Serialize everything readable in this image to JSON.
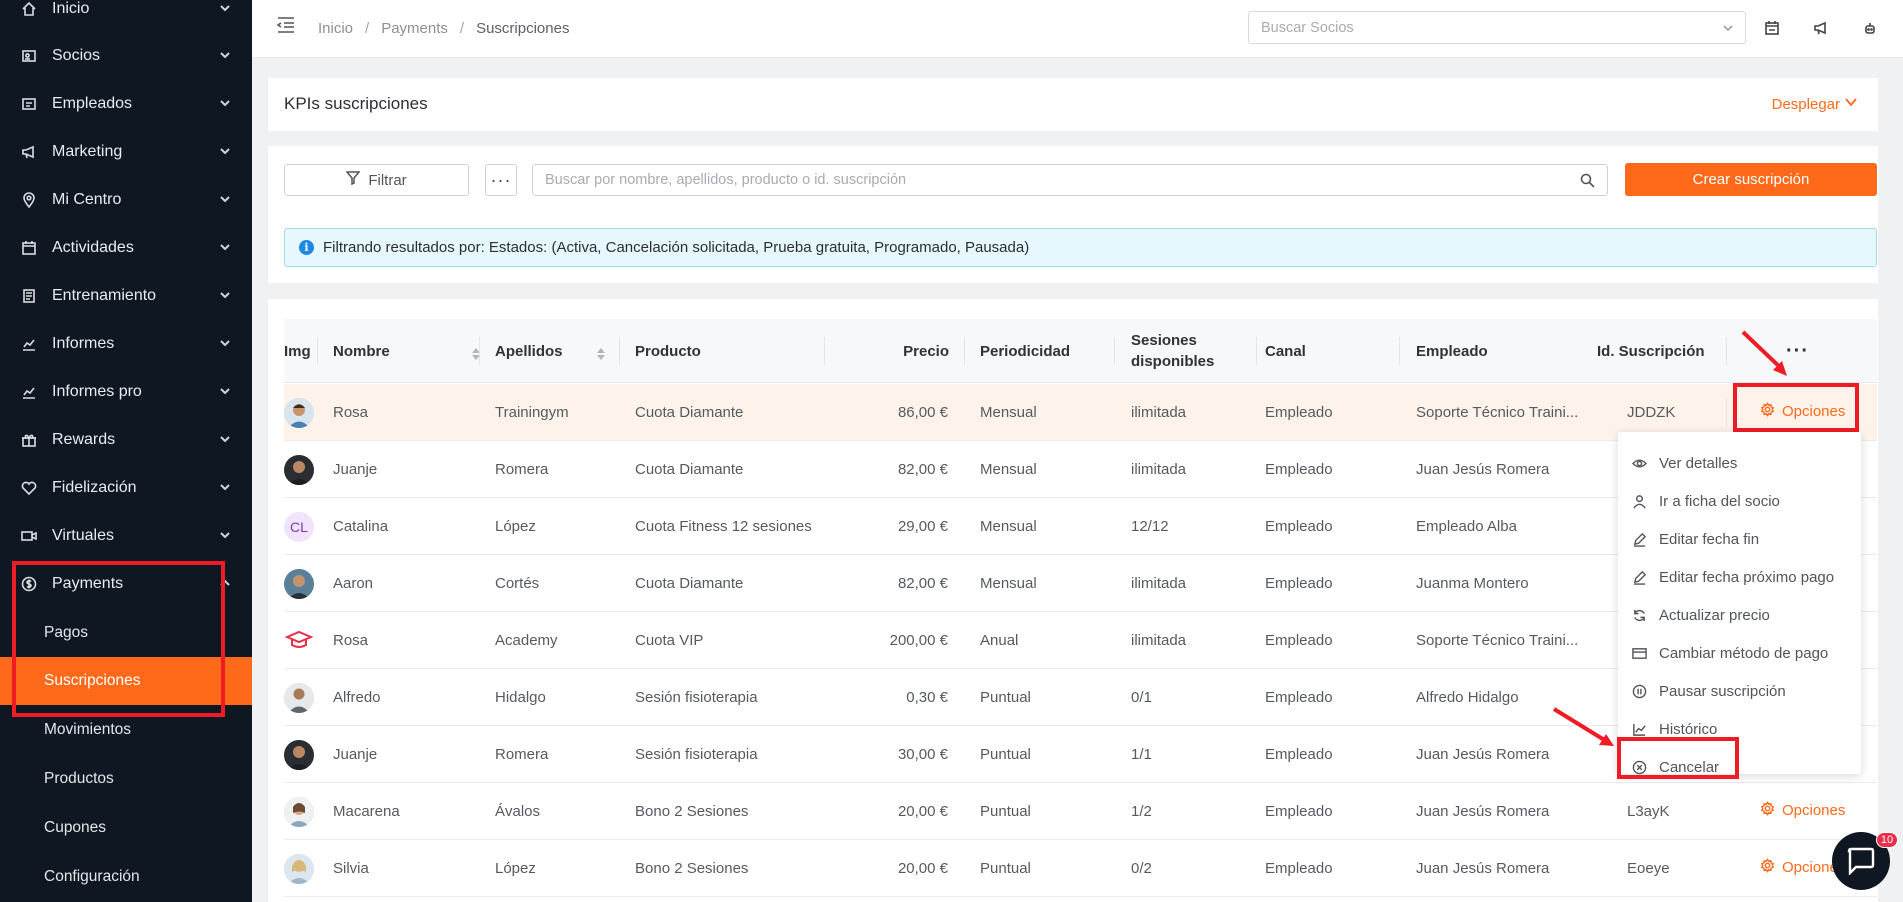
{
  "sidebar": {
    "items": [
      {
        "label": "Inicio",
        "icon": "home-icon"
      },
      {
        "label": "Socios",
        "icon": "id-card-icon"
      },
      {
        "label": "Empleados",
        "icon": "badge-icon"
      },
      {
        "label": "Marketing",
        "icon": "megaphone-icon"
      },
      {
        "label": "Mi Centro",
        "icon": "location-icon"
      },
      {
        "label": "Actividades",
        "icon": "calendar-icon"
      },
      {
        "label": "Entrenamiento",
        "icon": "clipboard-icon"
      },
      {
        "label": "Informes",
        "icon": "chart-line-icon"
      },
      {
        "label": "Informes pro",
        "icon": "chart-line-icon"
      },
      {
        "label": "Rewards",
        "icon": "gift-icon"
      },
      {
        "label": "Fidelización",
        "icon": "heart-icon"
      },
      {
        "label": "Virtuales",
        "icon": "video-icon"
      },
      {
        "label": "Payments",
        "icon": "coin-icon"
      }
    ],
    "payments_subitems": [
      "Pagos",
      "Suscripciones",
      "Movimientos",
      "Productos",
      "Cupones",
      "Configuración"
    ],
    "active_subitem": "Suscripciones"
  },
  "topbar": {
    "breadcrumb": [
      "Inicio",
      "Payments",
      "Suscripciones"
    ],
    "search_placeholder": "Buscar Socios"
  },
  "kpi": {
    "title": "KPIs suscripciones",
    "toggle_label": "Desplegar"
  },
  "filters": {
    "filter_label": "Filtrar",
    "more_label": "···",
    "search_placeholder": "Buscar por nombre, apellidos, producto o id. suscripción",
    "create_label": "Crear suscripción",
    "banner_text": "Filtrando resultados por: Estados: (Activa, Cancelación solicitada, Prueba gratuita, Programado, Pausada)"
  },
  "table": {
    "columns": [
      "Img",
      "Nombre",
      "Apellidos",
      "Producto",
      "Precio",
      "Periodicidad",
      "Sesiones disponibles",
      "Canal",
      "Empleado",
      "Id. Suscripción",
      "···"
    ],
    "rows": [
      {
        "avatar": "photo",
        "nombre": "Rosa",
        "apellidos": "Trainingym",
        "producto": "Cuota Diamante",
        "precio": "86,00 €",
        "periodicidad": "Mensual",
        "sesiones": "ilimitada",
        "canal": "Empleado",
        "empleado": "Soporte Técnico Traini...",
        "id": "JDDZK",
        "opciones": "Opciones"
      },
      {
        "avatar": "photo",
        "nombre": "Juanje",
        "apellidos": "Romera",
        "producto": "Cuota Diamante",
        "precio": "82,00 €",
        "periodicidad": "Mensual",
        "sesiones": "ilimitada",
        "canal": "Empleado",
        "empleado": "Juan Jesús Romera",
        "id": "",
        "opciones": ""
      },
      {
        "avatar": "CL",
        "nombre": "Catalina",
        "apellidos": "López",
        "producto": "Cuota Fitness 12 sesiones",
        "precio": "29,00 €",
        "periodicidad": "Mensual",
        "sesiones": "12/12",
        "canal": "Empleado",
        "empleado": "Empleado Alba",
        "id": "",
        "opciones": ""
      },
      {
        "avatar": "photo",
        "nombre": "Aaron",
        "apellidos": "Cortés",
        "producto": "Cuota Diamante",
        "precio": "82,00 €",
        "periodicidad": "Mensual",
        "sesiones": "ilimitada",
        "canal": "Empleado",
        "empleado": "Juanma Montero",
        "id": "",
        "opciones": ""
      },
      {
        "avatar": "logo",
        "nombre": "Rosa",
        "apellidos": "Academy",
        "producto": "Cuota VIP",
        "precio": "200,00 €",
        "periodicidad": "Anual",
        "sesiones": "ilimitada",
        "canal": "Empleado",
        "empleado": "Soporte Técnico Traini...",
        "id": "",
        "opciones": ""
      },
      {
        "avatar": "photo",
        "nombre": "Alfredo",
        "apellidos": "Hidalgo",
        "producto": "Sesión fisioterapia",
        "precio": "0,30 €",
        "periodicidad": "Puntual",
        "sesiones": "0/1",
        "canal": "Empleado",
        "empleado": "Alfredo Hidalgo",
        "id": "",
        "opciones": ""
      },
      {
        "avatar": "photo",
        "nombre": "Juanje",
        "apellidos": "Romera",
        "producto": "Sesión fisioterapia",
        "precio": "30,00 €",
        "periodicidad": "Puntual",
        "sesiones": "1/1",
        "canal": "Empleado",
        "empleado": "Juan Jesús Romera",
        "id": "",
        "opciones": ""
      },
      {
        "avatar": "photo",
        "nombre": "Macarena",
        "apellidos": "Ávalos",
        "producto": "Bono 2 Sesiones",
        "precio": "20,00 €",
        "periodicidad": "Puntual",
        "sesiones": "1/2",
        "canal": "Empleado",
        "empleado": "Juan Jesús Romera",
        "id": "L3ayK",
        "opciones": "Opciones"
      },
      {
        "avatar": "photo",
        "nombre": "Silvia",
        "apellidos": "López",
        "producto": "Bono 2 Sesiones",
        "precio": "20,00 €",
        "periodicidad": "Puntual",
        "sesiones": "0/2",
        "canal": "Empleado",
        "empleado": "Juan Jesús Romera",
        "id": "Eoeye",
        "opciones": "Opciones"
      }
    ]
  },
  "dropdown": {
    "items": [
      {
        "label": "Ver detalles",
        "icon": "eye-icon"
      },
      {
        "label": "Ir a ficha del socio",
        "icon": "user-icon"
      },
      {
        "label": "Editar fecha fin",
        "icon": "pencil-icon"
      },
      {
        "label": "Editar fecha próximo pago",
        "icon": "pencil-icon"
      },
      {
        "label": "Actualizar precio",
        "icon": "refresh-icon"
      },
      {
        "label": "Cambiar método de pago",
        "icon": "credit-card-icon"
      },
      {
        "label": "Pausar suscripción",
        "icon": "pause-icon"
      },
      {
        "label": "Histórico",
        "icon": "chart-line-icon"
      },
      {
        "label": "Cancelar",
        "icon": "x-circle-icon"
      }
    ]
  },
  "chat": {
    "badge": "10"
  },
  "colors": {
    "accent": "#ff6a1a",
    "sidebar_bg": "#0f1822",
    "annotation_red": "#ee1c25",
    "info_bg": "#e6f7fd"
  }
}
